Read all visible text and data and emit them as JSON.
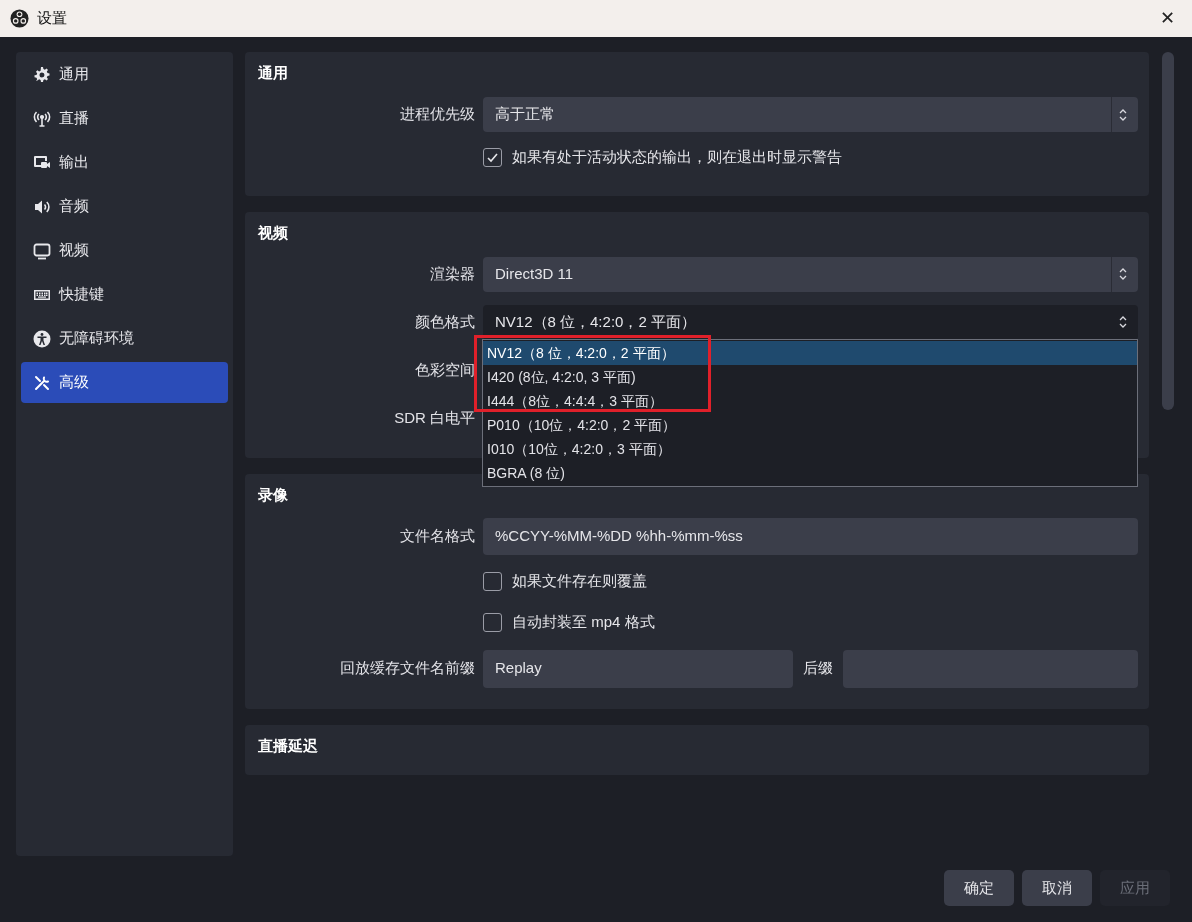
{
  "window": {
    "title": "设置",
    "close": "✕"
  },
  "sidebar": {
    "items": [
      {
        "label": "通用",
        "kind": "gear",
        "selected": false
      },
      {
        "label": "直播",
        "kind": "antenna",
        "selected": false
      },
      {
        "label": "输出",
        "kind": "output",
        "selected": false
      },
      {
        "label": "音频",
        "kind": "speaker",
        "selected": false
      },
      {
        "label": "视频",
        "kind": "monitor",
        "selected": false
      },
      {
        "label": "快捷键",
        "kind": "keyboard",
        "selected": false
      },
      {
        "label": "无障碍环境",
        "kind": "accessibility",
        "selected": false
      },
      {
        "label": "高级",
        "kind": "tools",
        "selected": true
      }
    ]
  },
  "sections": [
    {
      "title": "通用",
      "rows": [
        {
          "kind": "select",
          "label": "进程优先级",
          "value": "高于正常"
        },
        {
          "kind": "checkbox",
          "label": "如果有处于活动状态的输出，则在退出时显示警告",
          "checked": true
        }
      ]
    },
    {
      "title": "视频",
      "rows": [
        {
          "kind": "select",
          "label": "渲染器",
          "value": "Direct3D 11"
        },
        {
          "kind": "select",
          "label": "颜色格式",
          "value": "NV12（8 位，4:2:0，2 平面）",
          "expanded": true,
          "options": [
            {
              "label": "NV12（8 位，4:2:0，2 平面）",
              "selected": true
            },
            {
              "label": "I420 (8位, 4:2:0, 3 平面)",
              "selected": false
            },
            {
              "label": "I444（8位，4:4:4，3 平面）",
              "selected": false
            },
            {
              "label": "P010（10位，4:2:0，2 平面）",
              "selected": false
            },
            {
              "label": "I010（10位，4:2:0，3 平面）",
              "selected": false
            },
            {
              "label": "BGRA (8 位)",
              "selected": false
            }
          ]
        },
        {
          "kind": "label",
          "label": "色彩空间"
        },
        {
          "kind": "label",
          "label": "SDR 白电平"
        }
      ]
    },
    {
      "title": "录像",
      "rows": [
        {
          "kind": "text",
          "label": "文件名格式",
          "value": "%CCYY-%MM-%DD %hh-%mm-%ss"
        },
        {
          "kind": "checkbox",
          "label": "如果文件存在则覆盖",
          "checked": false
        },
        {
          "kind": "checkbox",
          "label": "自动封装至 mp4 格式",
          "checked": false
        },
        {
          "kind": "pair",
          "label": "回放缓存文件名前缀",
          "value": "Replay",
          "label2": "后缀"
        }
      ]
    },
    {
      "title": "直播延迟"
    }
  ],
  "buttons": [
    {
      "label": "确定",
      "disabled": false
    },
    {
      "label": "取消",
      "disabled": false
    },
    {
      "label": "应用",
      "disabled": true
    }
  ]
}
